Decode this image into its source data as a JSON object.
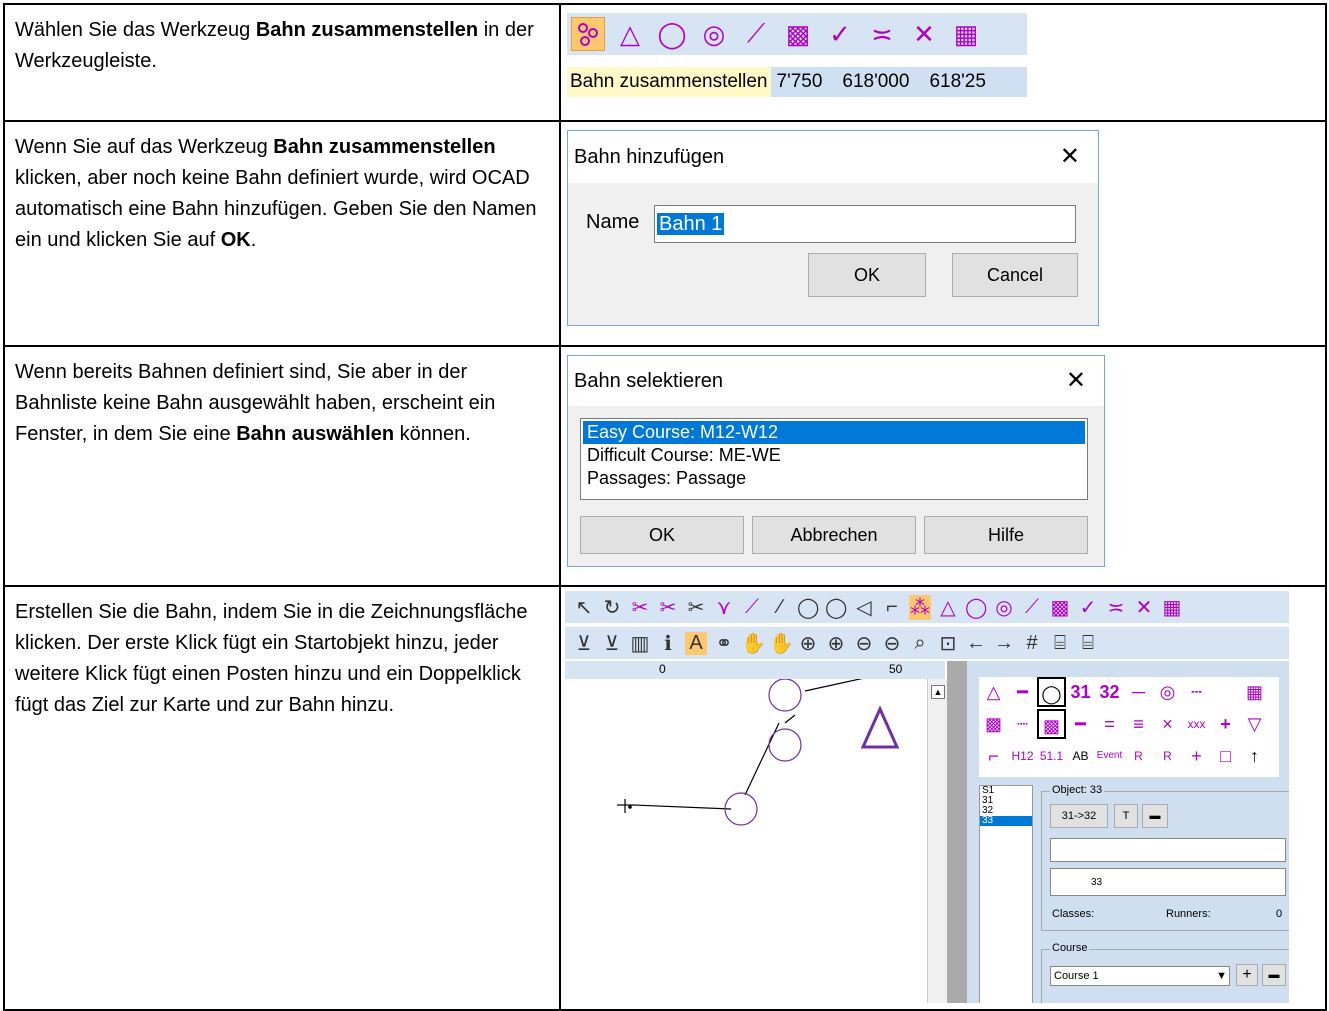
{
  "rows": [
    {
      "text_parts": [
        "Wählen Sie das Werkzeug ",
        "Bahn zusammenstellen",
        " in der Werkzeugleiste."
      ]
    },
    {
      "text_parts": [
        "Wenn Sie auf das Werkzeug ",
        "Bahn zusammenstellen",
        " klicken, aber noch keine Bahn definiert wurde, wird OCAD automatisch eine Bahn hinzufügen. Geben Sie den Namen ein und klicken Sie auf ",
        "OK",
        "."
      ]
    },
    {
      "text_parts": [
        "Wenn bereits Bahnen definiert sind, Sie aber in der Bahnliste keine Bahn ausgewählt haben, erscheint ein Fenster, in dem Sie eine ",
        "Bahn auswählen",
        " können."
      ]
    },
    {
      "text": "Erstellen Sie die Bahn, indem Sie in die Zeichnungsfläche klicken. Der erste Klick fügt ein Startobjekt hinzu, jeder weitere Klick fügt einen Posten hinzu und ein Doppelklick fügt das Ziel zur Karte und zur Bahn hinzu."
    }
  ],
  "toolbar1": {
    "status_label": "Bahn zusammenstellen",
    "coords": [
      "7'750",
      "618'000",
      "618'25"
    ],
    "icons": [
      "course-tool-icon",
      "triangle-icon",
      "circle-icon",
      "double-circle-icon",
      "line-icon",
      "hatch-icon",
      "check-icon",
      "equals-icon",
      "cross-icon",
      "table-icon"
    ]
  },
  "dialog_add": {
    "title": "Bahn hinzufügen",
    "name_label": "Name",
    "name_value": "Bahn 1",
    "ok": "OK",
    "cancel": "Cancel"
  },
  "dialog_select": {
    "title": "Bahn selektieren",
    "items": [
      "Easy Course: M12-W12",
      "Difficult Course: ME-WE",
      "Passages: Passage"
    ],
    "selected_index": 0,
    "ok": "OK",
    "cancel": "Abbrechen",
    "help": "Hilfe"
  },
  "app": {
    "ruler_labels": [
      "0",
      "50"
    ],
    "symbols_row1": [
      "△",
      "━",
      "◯",
      "31",
      "32",
      "─",
      "◎",
      "┄",
      "▦"
    ],
    "symbols_row2": [
      "▩",
      "┈",
      "▩",
      "━",
      "=",
      "≡",
      "×",
      "xxx",
      "+",
      "▽"
    ],
    "symbols_row3": [
      "⌐",
      "H12",
      "51.1",
      "AB",
      "Event",
      "R",
      "R",
      "+",
      "□",
      "↑"
    ],
    "course_list": [
      "S1",
      "31",
      "32",
      "33"
    ],
    "course_list_selected": 3,
    "object_title": "Object: 33",
    "object_link": "31->32",
    "object_t": "T",
    "object_number": "33",
    "classes_label": "Classes:",
    "runners_label": "Runners:",
    "runners_value": "0",
    "course_group_title": "Course",
    "course_value": "Course 1"
  },
  "colors": {
    "accent": "#b000c8",
    "selection": "#0078d7",
    "toolbar_bg": "#d6e4f4",
    "tool_highlight": "#ffc86e"
  }
}
